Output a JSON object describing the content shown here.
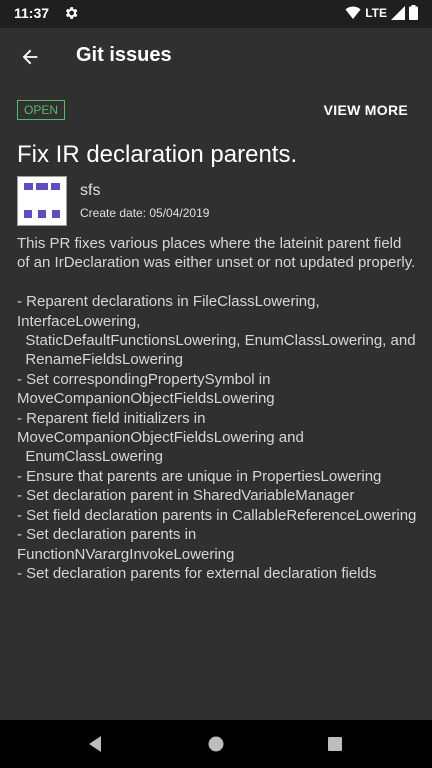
{
  "status_bar": {
    "time": "11:37",
    "network": "LTE"
  },
  "app_bar": {
    "title": "Git issues"
  },
  "issue": {
    "state": "OPEN",
    "view_more": "VIEW MORE",
    "title": "Fix IR declaration parents.",
    "author": "sfs",
    "create_date": "Create date: 05/04/2019",
    "body": "This PR fixes various places where the lateinit parent field of an IrDeclaration was either unset or not updated properly.\n\n- Reparent declarations in FileClassLowering, InterfaceLowering,\n  StaticDefaultFunctionsLowering, EnumClassLowering, and\n  RenameFieldsLowering\n- Set correspondingPropertySymbol in MoveCompanionObjectFieldsLowering\n- Reparent field initializers in MoveCompanionObjectFieldsLowering and\n  EnumClassLowering\n- Ensure that parents are unique in PropertiesLowering\n- Set declaration parent in SharedVariableManager\n- Set field declaration parents in CallableReferenceLowering\n- Set declaration parents in FunctionNVarargInvokeLowering\n- Set declaration parents for external declaration fields"
  },
  "colors": {
    "background": "#303030",
    "status_bar": "#1f1f1f",
    "open_badge": "#55b96a",
    "avatar_pattern": "#5b4fbf",
    "nav_bar": "#000000"
  },
  "icons": {
    "status": [
      "gear-icon",
      "wifi-icon",
      "signal-icon",
      "battery-icon"
    ],
    "app_bar": [
      "back-arrow-icon"
    ],
    "nav": [
      "back-triangle-icon",
      "home-circle-icon",
      "recents-square-icon"
    ]
  }
}
